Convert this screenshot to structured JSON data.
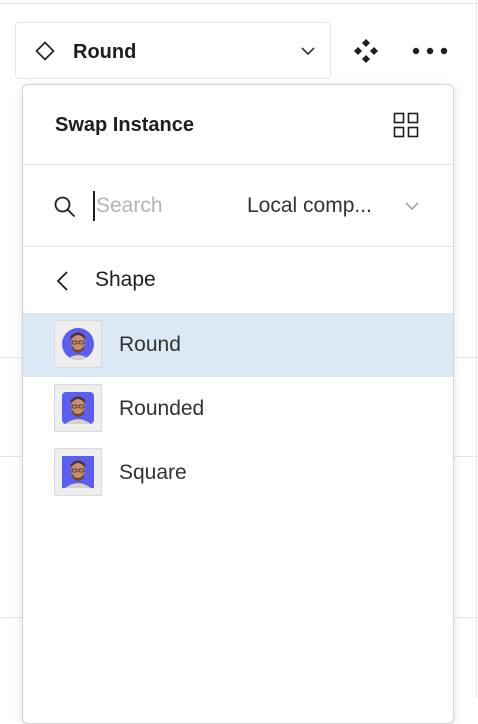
{
  "instance_selector": {
    "label": "Round",
    "icon": "component-instance-icon",
    "dropdown_icon": "chevron-down-icon"
  },
  "toolbar": {
    "go_to_main_icon": "go-to-main-component-icon",
    "more_icon": "more-options-icon"
  },
  "popover": {
    "title": "Swap Instance",
    "view_toggle_icon": "grid-view-icon",
    "search": {
      "value": "",
      "placeholder": "Search"
    },
    "scope_select": {
      "value": "Local comp..."
    },
    "breadcrumb": {
      "label": "Shape",
      "icon": "chevron-left-icon"
    },
    "items": [
      {
        "label": "Round",
        "thumbnail": "round-avatar",
        "selected": true
      },
      {
        "label": "Rounded",
        "thumbnail": "rounded-avatar",
        "selected": false
      },
      {
        "label": "Square",
        "thumbnail": "square-avatar",
        "selected": false
      }
    ]
  },
  "colors": {
    "selected_row": "#dbe9f6",
    "avatar_background": "#5b5ef0",
    "text": "#1e1e1e",
    "border": "#e6e6e6"
  }
}
